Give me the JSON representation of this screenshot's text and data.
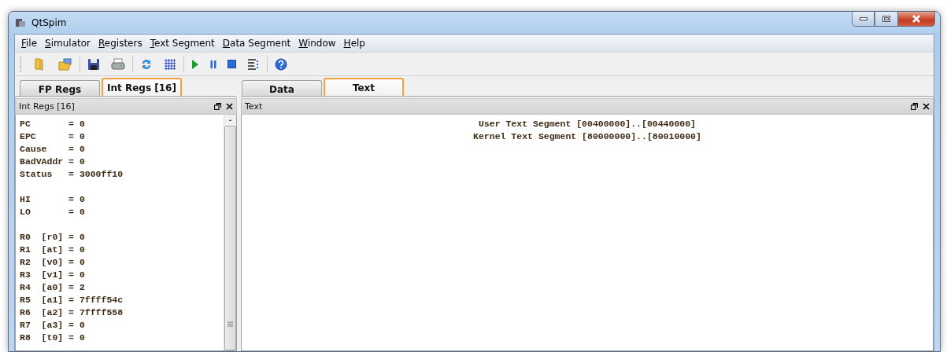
{
  "window": {
    "title": "QtSpim"
  },
  "menu": [
    "File",
    "Simulator",
    "Registers",
    "Text Segment",
    "Data Segment",
    "Window",
    "Help"
  ],
  "left_tabs": [
    {
      "label": "FP Regs",
      "selected": false
    },
    {
      "label": "Int Regs [16]",
      "selected": true
    }
  ],
  "right_tabs": [
    {
      "label": "Data",
      "selected": false
    },
    {
      "label": "Text",
      "selected": true
    }
  ],
  "registers_panel": {
    "title": "Int Regs [16]",
    "groups": [
      [
        "PC       = 0",
        "EPC      = 0",
        "Cause    = 0",
        "BadVAddr = 0",
        "Status   = 3000ff10"
      ],
      [
        "HI       = 0",
        "LO       = 0"
      ],
      [
        "R0  [r0] = 0",
        "R1  [at] = 0",
        "R2  [v0] = 0",
        "R3  [v1] = 0",
        "R4  [a0] = 2",
        "R5  [a1] = 7ffff54c",
        "R6  [a2] = 7ffff558",
        "R7  [a3] = 0",
        "R8  [t0] = 0"
      ]
    ]
  },
  "text_panel": {
    "title": "Text",
    "lines": [
      "User Text Segment [00400000]..[00440000]",
      "Kernel Text Segment [80000000]..[80010000]"
    ]
  }
}
